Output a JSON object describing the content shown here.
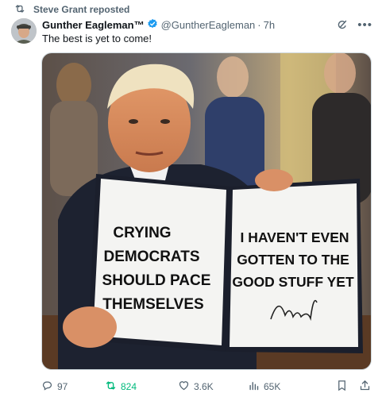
{
  "repost": {
    "text": "Steve Grant reposted",
    "icon": "repost-icon"
  },
  "author": {
    "name": "Gunther Eagleman™",
    "handle": "@GuntherEagleman",
    "separator": "·",
    "time": "7h",
    "verified_color": "#1d9bf0",
    "avatar": "avatar-image"
  },
  "tweet": {
    "text": "The best is yet to come!"
  },
  "media": {
    "left_page": [
      "CRYING",
      "DEMOCRATS",
      "SHOULD PACE",
      "THEMSELVES"
    ],
    "right_page": [
      "I HAVEN'T EVEN",
      "GOTTEN TO THE",
      "GOOD STUFF YET"
    ]
  },
  "actions": {
    "replies": "97",
    "reposts": "824",
    "likes": "3.6K",
    "views": "65K",
    "repost_color": "#00ba7c",
    "icons": [
      "reply-icon",
      "repost-icon",
      "like-icon",
      "views-icon",
      "bookmark-icon",
      "share-icon"
    ]
  }
}
